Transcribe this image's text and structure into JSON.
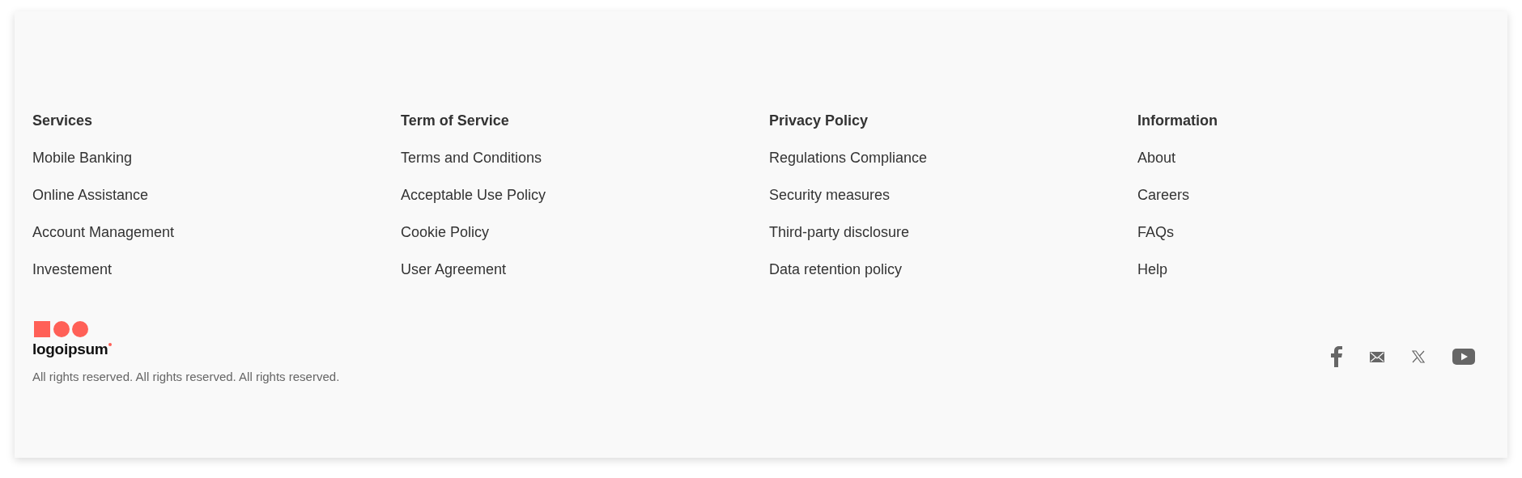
{
  "columns": [
    {
      "heading": "Services",
      "links": [
        "Mobile Banking",
        "Online Assistance",
        "Account Management",
        "Investement"
      ]
    },
    {
      "heading": "Term of Service",
      "links": [
        "Terms and Conditions",
        "Acceptable Use Policy",
        "Cookie Policy",
        "User Agreement"
      ]
    },
    {
      "heading": "Privacy Policy",
      "links": [
        "Regulations Compliance",
        "Security measures",
        "Third-party disclosure",
        "Data retention policy"
      ]
    },
    {
      "heading": "Information",
      "links": [
        "About",
        "Careers",
        "FAQs",
        "Help"
      ]
    }
  ],
  "brand": {
    "name": "logoipsum"
  },
  "copyright": "All rights reserved. All rights reserved. All rights reserved."
}
